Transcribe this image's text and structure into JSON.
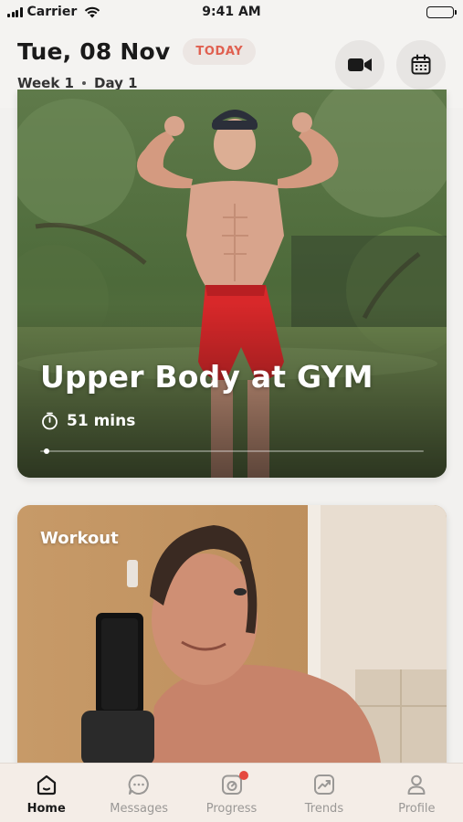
{
  "status_bar": {
    "carrier": "Carrier",
    "time": "9:41 AM"
  },
  "header": {
    "date": "Tue, 08 Nov",
    "today_badge": "TODAY",
    "week": "Week 1",
    "day": "Day 1",
    "buttons": [
      "video-camera-icon",
      "calendar-icon"
    ]
  },
  "cards": [
    {
      "title": "Upper Body at GYM",
      "duration": "51 mins",
      "progress": 0.01
    },
    {
      "label": "Workout"
    }
  ],
  "tabbar": {
    "tabs": [
      {
        "label": "Home",
        "icon": "home-icon",
        "active": true
      },
      {
        "label": "Messages",
        "icon": "messages-icon",
        "active": false
      },
      {
        "label": "Progress",
        "icon": "progress-icon",
        "active": false,
        "badge": true
      },
      {
        "label": "Trends",
        "icon": "trends-icon",
        "active": false
      },
      {
        "label": "Profile",
        "icon": "profile-icon",
        "active": false
      }
    ]
  },
  "colors": {
    "accent": "#e06050",
    "badge": "#e5493f",
    "tabbar_bg": "#f4ede7"
  }
}
